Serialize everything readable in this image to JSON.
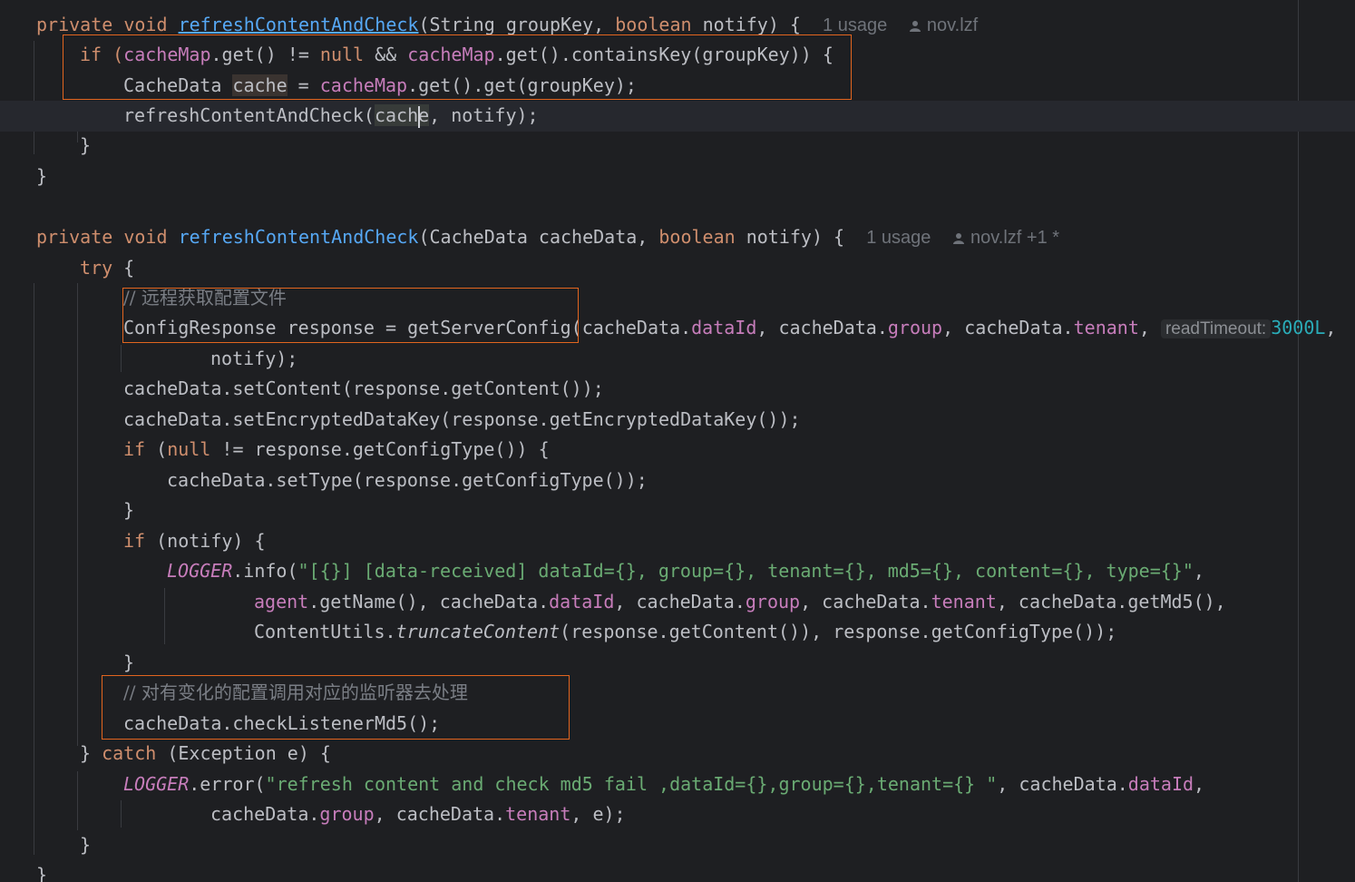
{
  "editor": {
    "method1": {
      "signature": {
        "kw_private": "private",
        "kw_void": "void",
        "name": "refreshContentAndCheck",
        "open": "(",
        "type_string": "String",
        "param_group": "groupKey",
        "comma": ", ",
        "kw_boolean": "boolean",
        "param_notify": "notify",
        "close": ") {",
        "usages": "1 usage",
        "author": "nov.lzf"
      },
      "l2": [
        "if (",
        "cacheMap",
        ".get() != ",
        "null",
        " && ",
        "cacheMap",
        ".get().containsKey(groupKey)) {"
      ],
      "l3": [
        "CacheData ",
        "cache",
        " = ",
        "cacheMap",
        ".get().get(groupKey);"
      ],
      "l4": [
        "refreshContentAndCheck(",
        "cache",
        ", notify);"
      ],
      "l5": "}",
      "l6": "}"
    },
    "method2": {
      "signature": {
        "kw_private": "private",
        "kw_void": "void",
        "name": "refreshContentAndCheck",
        "params_a": "(CacheData cacheData, ",
        "kw_boolean": "boolean",
        "params_b": " notify) {",
        "usages": "1 usage",
        "author": "nov.lzf +1 *"
      },
      "try": [
        "try",
        " {"
      ],
      "comment1": "// 远程获取配置文件",
      "l_resp": [
        "ConfigResponse response = getServerConfig(cacheData.",
        "dataId",
        ", cacheData.",
        "group",
        ", cacheData.",
        "tenant",
        ", "
      ],
      "hint_read_timeout": "readTimeout:",
      "read_timeout_value": "3000L",
      "read_timeout_tail": ",",
      "l_notify": "notify);",
      "l_setcontent": "cacheData.setContent(response.getContent());",
      "l_setkey": "cacheData.setEncryptedDataKey(response.getEncryptedDataKey());",
      "l_if_null": [
        "if (",
        "null",
        " != response.getConfigType()) {"
      ],
      "l_settype": "cacheData.setType(response.getConfigType());",
      "l_close1": "}",
      "l_if_notify": "if (notify) {",
      "l_logger_info": [
        "LOGGER",
        ".info(",
        "\"[{}] [data-received] dataId={}, group={}, tenant={}, md5={}, content={}, type={}\"",
        ","
      ],
      "l_agent": [
        "agent",
        ".getName(), cacheData.",
        "dataId",
        ", cacheData.",
        "group",
        ", cacheData.",
        "tenant",
        ", cacheData.getMd5(),"
      ],
      "l_content_utils": [
        "ContentUtils.",
        "truncateContent",
        "(response.getContent()), response.getConfigType());"
      ],
      "l_close2": "}",
      "comment2": "// 对有变化的配置调用对应的监听器去处理",
      "l_check": "cacheData.checkListenerMd5();",
      "l_catch": [
        "} ",
        "catch",
        " (Exception e) {"
      ],
      "l_logger_error": [
        "LOGGER",
        ".error(",
        "\"refresh content and check md5 fail ,dataId={},group={},tenant={} \"",
        ", cacheData.",
        "dataId",
        ","
      ],
      "l_error_args": [
        "cacheData.",
        "group",
        ", cacheData.",
        "tenant",
        ", e);"
      ],
      "l_close3": "}",
      "l_close4": "}"
    }
  },
  "colors": {
    "background": "#1e1f22",
    "keyword": "#cf8e6d",
    "function": "#56a8f5",
    "field": "#c77dbb",
    "string": "#6aab73",
    "comment": "#7a7e85",
    "number": "#2aacb8",
    "highlight_box": "#e2651f"
  },
  "icons": [
    "person-icon",
    "person-icon"
  ]
}
